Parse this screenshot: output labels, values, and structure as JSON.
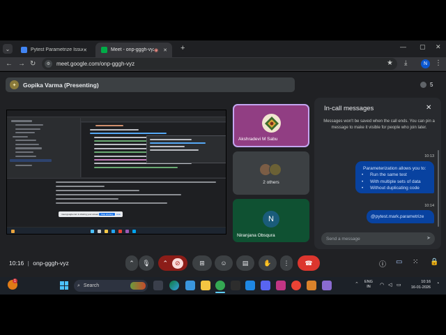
{
  "browser": {
    "tabs": [
      {
        "label": "Pytest Parametrize Issue",
        "favicon_color": "#4285f4",
        "active": false
      },
      {
        "label": "Meet - onp-gggh-vyz",
        "favicon_color": "#00ac47",
        "active": true
      }
    ],
    "url": "meet.google.com/onp-gggh-vyz",
    "profile_initial": "N"
  },
  "meet": {
    "presenter": "Gopika Varma (Presenting)",
    "participant_count": "5",
    "tiles": [
      {
        "name": "Akshradevi M Sabu"
      },
      {
        "name": "2 others"
      },
      {
        "name": "Niranjana Obsqura",
        "initial": "N"
      }
    ],
    "shared_screen": {
      "share_notice": "meet.google.com is sharing your screen.",
      "stop_label": "Stop sharing",
      "hide_label": "Hide"
    },
    "messages": {
      "title": "In-call messages",
      "notice": "Messages won't be saved when the call ends. You can pin a message to make it visible for people who join later.",
      "items": [
        {
          "time": "10:13",
          "heading": "Parameterization allows you to:",
          "bullets": [
            "Run the same test",
            "With multiple sets of data",
            "Without duplicating code"
          ]
        },
        {
          "time": "10:14",
          "text": "@pytest.mark.parametrize"
        }
      ],
      "input_placeholder": "Send a message"
    },
    "meeting_time": "10:16",
    "meeting_code": "onp-gggh-vyz",
    "colors": {
      "leave": "#dc362e",
      "bubble": "#0842a0",
      "tile_highlight": "#913e83"
    }
  },
  "taskbar": {
    "weather_badge": "1",
    "search_placeholder": "Search",
    "lang_top": "ENG",
    "lang_bottom": "IN",
    "time": "10:16",
    "date": "16-01-2026"
  }
}
